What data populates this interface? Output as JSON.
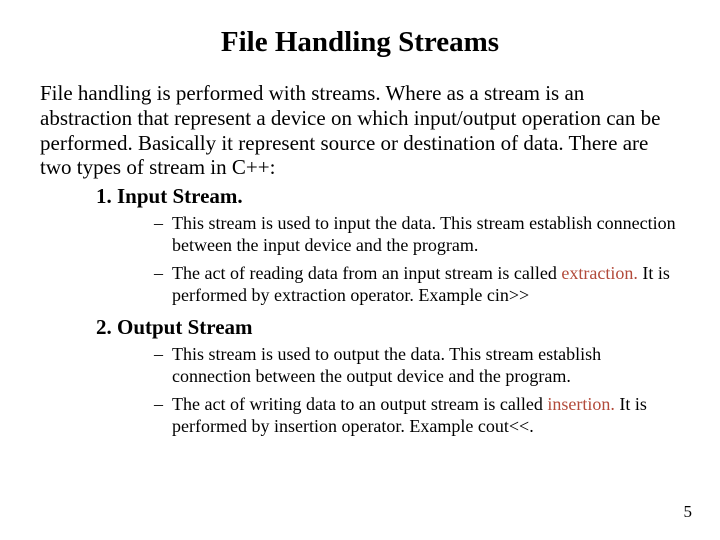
{
  "title": "File Handling Streams",
  "intro": "File handling is performed with streams. Where as a stream is an abstraction that represent a device on which input/output operation can be performed. Basically it represent source or destination of data. There are two types of stream in C++:",
  "item1": {
    "heading": "1. Input Stream.",
    "b1": "This stream is used to input the data. This stream establish connection between the input device and the program.",
    "b2a": "The act of reading data from an input stream is called ",
    "b2hl": "extraction.",
    "b2b": " It is performed by extraction operator. Example cin>>"
  },
  "item2": {
    "heading": "2. Output Stream",
    "b1": "This stream is used to output the data. This stream establish connection between the output device and the program.",
    "b2a": "The act of writing data to an output stream is called ",
    "b2hl": "insertion.",
    "b2b": " It is performed by insertion operator. Example cout<<."
  },
  "pageNumber": "5"
}
